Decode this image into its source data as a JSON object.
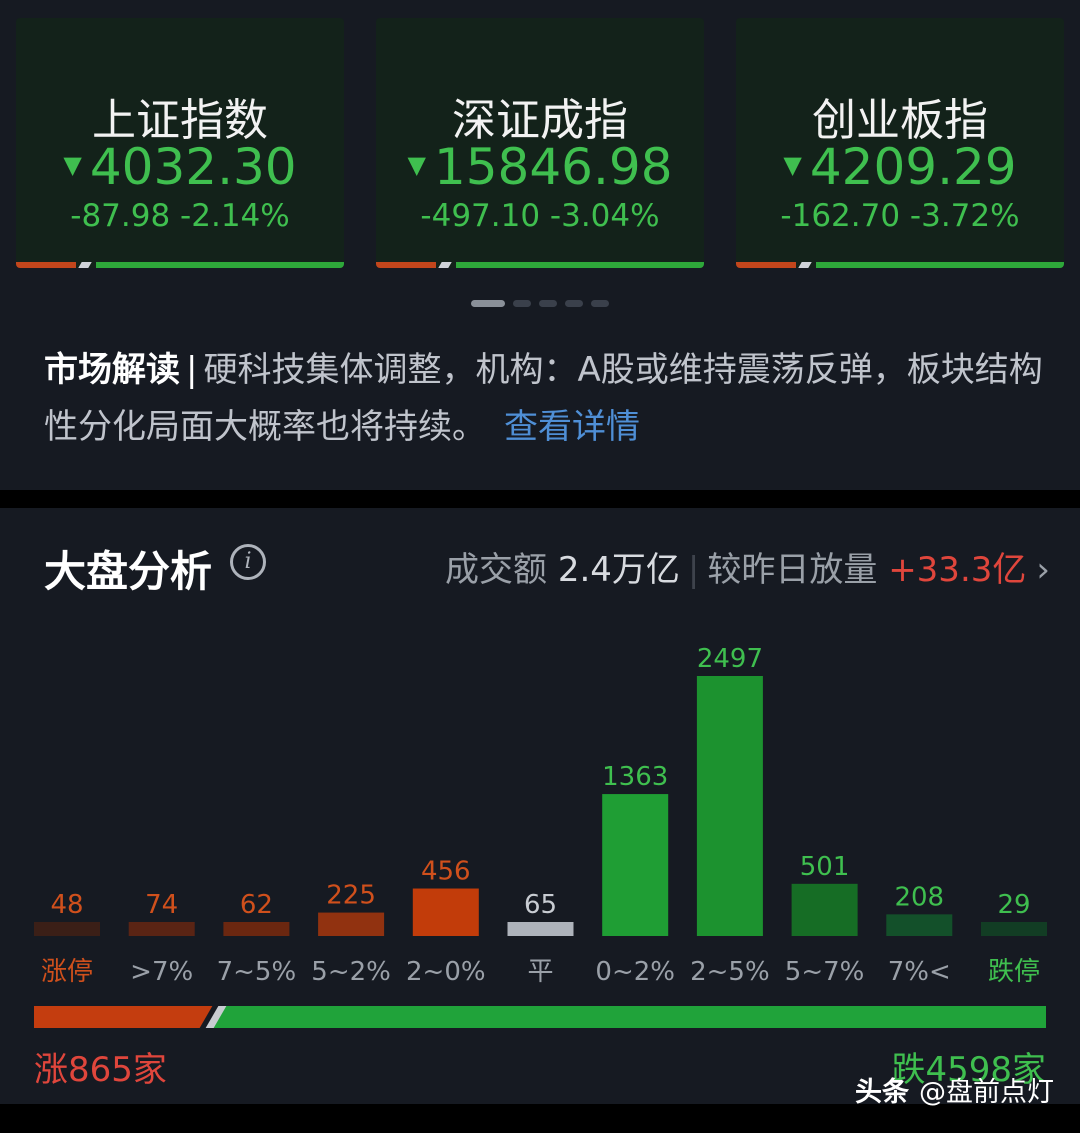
{
  "indices": [
    {
      "name": "上证指数",
      "price": "4032.30",
      "change": "-87.98 -2.14%"
    },
    {
      "name": "深证成指",
      "price": "15846.98",
      "change": "-497.10 -3.04%"
    },
    {
      "name": "创业板指",
      "price": "4209.29",
      "change": "-162.70 -3.72%"
    }
  ],
  "down_arrow": "▼",
  "market": {
    "lead": "市场解读",
    "separator": "|",
    "text": "硬科技集体调整，机构：A股或维持震荡反弹，板块结构性分化局面大概率也将持续。",
    "more": "查看详情"
  },
  "analysis": {
    "title": "大盘分析",
    "info_icon": "i",
    "volume_label": "成交额",
    "volume_value": "2.4万亿",
    "separator": "|",
    "compare_label": "较昨日放量",
    "compare_value": "+33.3亿",
    "chevron": "›"
  },
  "chart_data": {
    "type": "bar",
    "categories": [
      "涨停",
      ">7%",
      "7~5%",
      "5~2%",
      "2~0%",
      "平",
      "0~2%",
      "2~5%",
      "5~7%",
      "7%<",
      "跌停"
    ],
    "values": [
      48,
      74,
      62,
      225,
      456,
      65,
      1363,
      2497,
      501,
      208,
      29
    ],
    "colors": [
      "#3b1f17",
      "#5a2414",
      "#6b2710",
      "#913210",
      "#c23c0a",
      "#aeb3bb",
      "#1f9e34",
      "#1c922f",
      "#166d25",
      "#13502a",
      "#123d24"
    ],
    "label_colors": [
      "#d0501c",
      "#d0501c",
      "#d0501c",
      "#d0501c",
      "#d0501c",
      "#c8ccd2",
      "#3fbf4f",
      "#3fbf4f",
      "#3fbf4f",
      "#3fbf4f",
      "#3fbf4f"
    ],
    "tick_colors": [
      "#d0501c",
      "#9aa0a8",
      "#9aa0a8",
      "#9aa0a8",
      "#9aa0a8",
      "#9aa0a8",
      "#9aa0a8",
      "#9aa0a8",
      "#9aa0a8",
      "#9aa0a8",
      "#3fbf4f"
    ]
  },
  "breadth": {
    "up": "涨865家",
    "down": "跌4598家",
    "up_count": 865,
    "down_count": 4598
  },
  "watermark": {
    "brand": "头条",
    "account": "@盘前点灯"
  }
}
